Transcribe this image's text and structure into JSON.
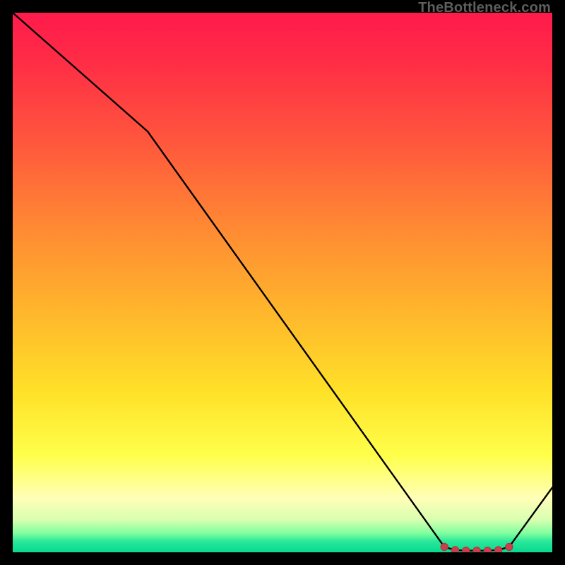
{
  "watermark": "TheBottleneck.com",
  "colors": {
    "frame": "#000000",
    "line": "#000000",
    "marker_fill": "#ca3f4a",
    "marker_stroke": "#b6303f",
    "gradient_top": "#ff1a4c",
    "gradient_mid": "#ffe028",
    "gradient_bottom": "#09d98f"
  },
  "chart_data": {
    "type": "line",
    "title": "",
    "xlabel": "",
    "ylabel": "",
    "xlim": [
      0,
      100
    ],
    "ylim": [
      0,
      100
    ],
    "grid": false,
    "legend": false,
    "series": [
      {
        "name": "curve",
        "x": [
          0,
          25,
          80,
          82,
          84,
          86,
          88,
          90,
          92,
          100
        ],
        "values": [
          100,
          78,
          1,
          0.4,
          0.3,
          0.3,
          0.3,
          0.4,
          1,
          12
        ]
      }
    ],
    "markers": {
      "x": [
        80,
        82,
        84,
        86,
        88,
        90,
        92
      ],
      "values": [
        1,
        0.4,
        0.3,
        0.3,
        0.3,
        0.4,
        1
      ]
    }
  }
}
